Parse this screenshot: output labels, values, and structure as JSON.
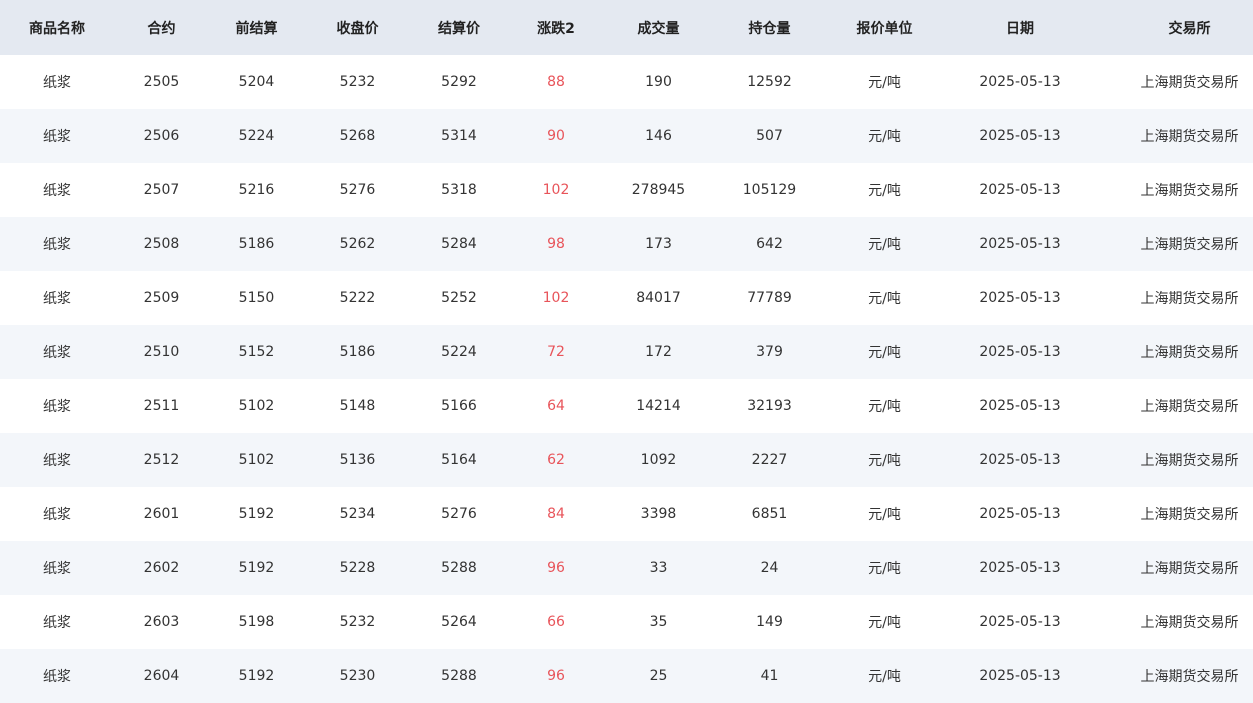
{
  "table": {
    "headers": [
      "商品名称",
      "合约",
      "前结算",
      "收盘价",
      "结算价",
      "涨跌2",
      "成交量",
      "持仓量",
      "报价单位",
      "日期",
      "交易所"
    ],
    "rows": [
      [
        "纸浆",
        "2505",
        "5204",
        "5232",
        "5292",
        "88",
        "190",
        "12592",
        "元/吨",
        "2025-05-13",
        "上海期货交易所"
      ],
      [
        "纸浆",
        "2506",
        "5224",
        "5268",
        "5314",
        "90",
        "146",
        "507",
        "元/吨",
        "2025-05-13",
        "上海期货交易所"
      ],
      [
        "纸浆",
        "2507",
        "5216",
        "5276",
        "5318",
        "102",
        "278945",
        "105129",
        "元/吨",
        "2025-05-13",
        "上海期货交易所"
      ],
      [
        "纸浆",
        "2508",
        "5186",
        "5262",
        "5284",
        "98",
        "173",
        "642",
        "元/吨",
        "2025-05-13",
        "上海期货交易所"
      ],
      [
        "纸浆",
        "2509",
        "5150",
        "5222",
        "5252",
        "102",
        "84017",
        "77789",
        "元/吨",
        "2025-05-13",
        "上海期货交易所"
      ],
      [
        "纸浆",
        "2510",
        "5152",
        "5186",
        "5224",
        "72",
        "172",
        "379",
        "元/吨",
        "2025-05-13",
        "上海期货交易所"
      ],
      [
        "纸浆",
        "2511",
        "5102",
        "5148",
        "5166",
        "64",
        "14214",
        "32193",
        "元/吨",
        "2025-05-13",
        "上海期货交易所"
      ],
      [
        "纸浆",
        "2512",
        "5102",
        "5136",
        "5164",
        "62",
        "1092",
        "2227",
        "元/吨",
        "2025-05-13",
        "上海期货交易所"
      ],
      [
        "纸浆",
        "2601",
        "5192",
        "5234",
        "5276",
        "84",
        "3398",
        "6851",
        "元/吨",
        "2025-05-13",
        "上海期货交易所"
      ],
      [
        "纸浆",
        "2602",
        "5192",
        "5228",
        "5288",
        "96",
        "33",
        "24",
        "元/吨",
        "2025-05-13",
        "上海期货交易所"
      ],
      [
        "纸浆",
        "2603",
        "5198",
        "5232",
        "5264",
        "66",
        "35",
        "149",
        "元/吨",
        "2025-05-13",
        "上海期货交易所"
      ],
      [
        "纸浆",
        "2604",
        "5192",
        "5230",
        "5288",
        "96",
        "25",
        "41",
        "元/吨",
        "2025-05-13",
        "上海期货交易所"
      ]
    ]
  },
  "colors": {
    "header_bg": "#e4e9f1",
    "row_alt_bg": "#f3f6fa",
    "up_color": "#e8545a"
  }
}
